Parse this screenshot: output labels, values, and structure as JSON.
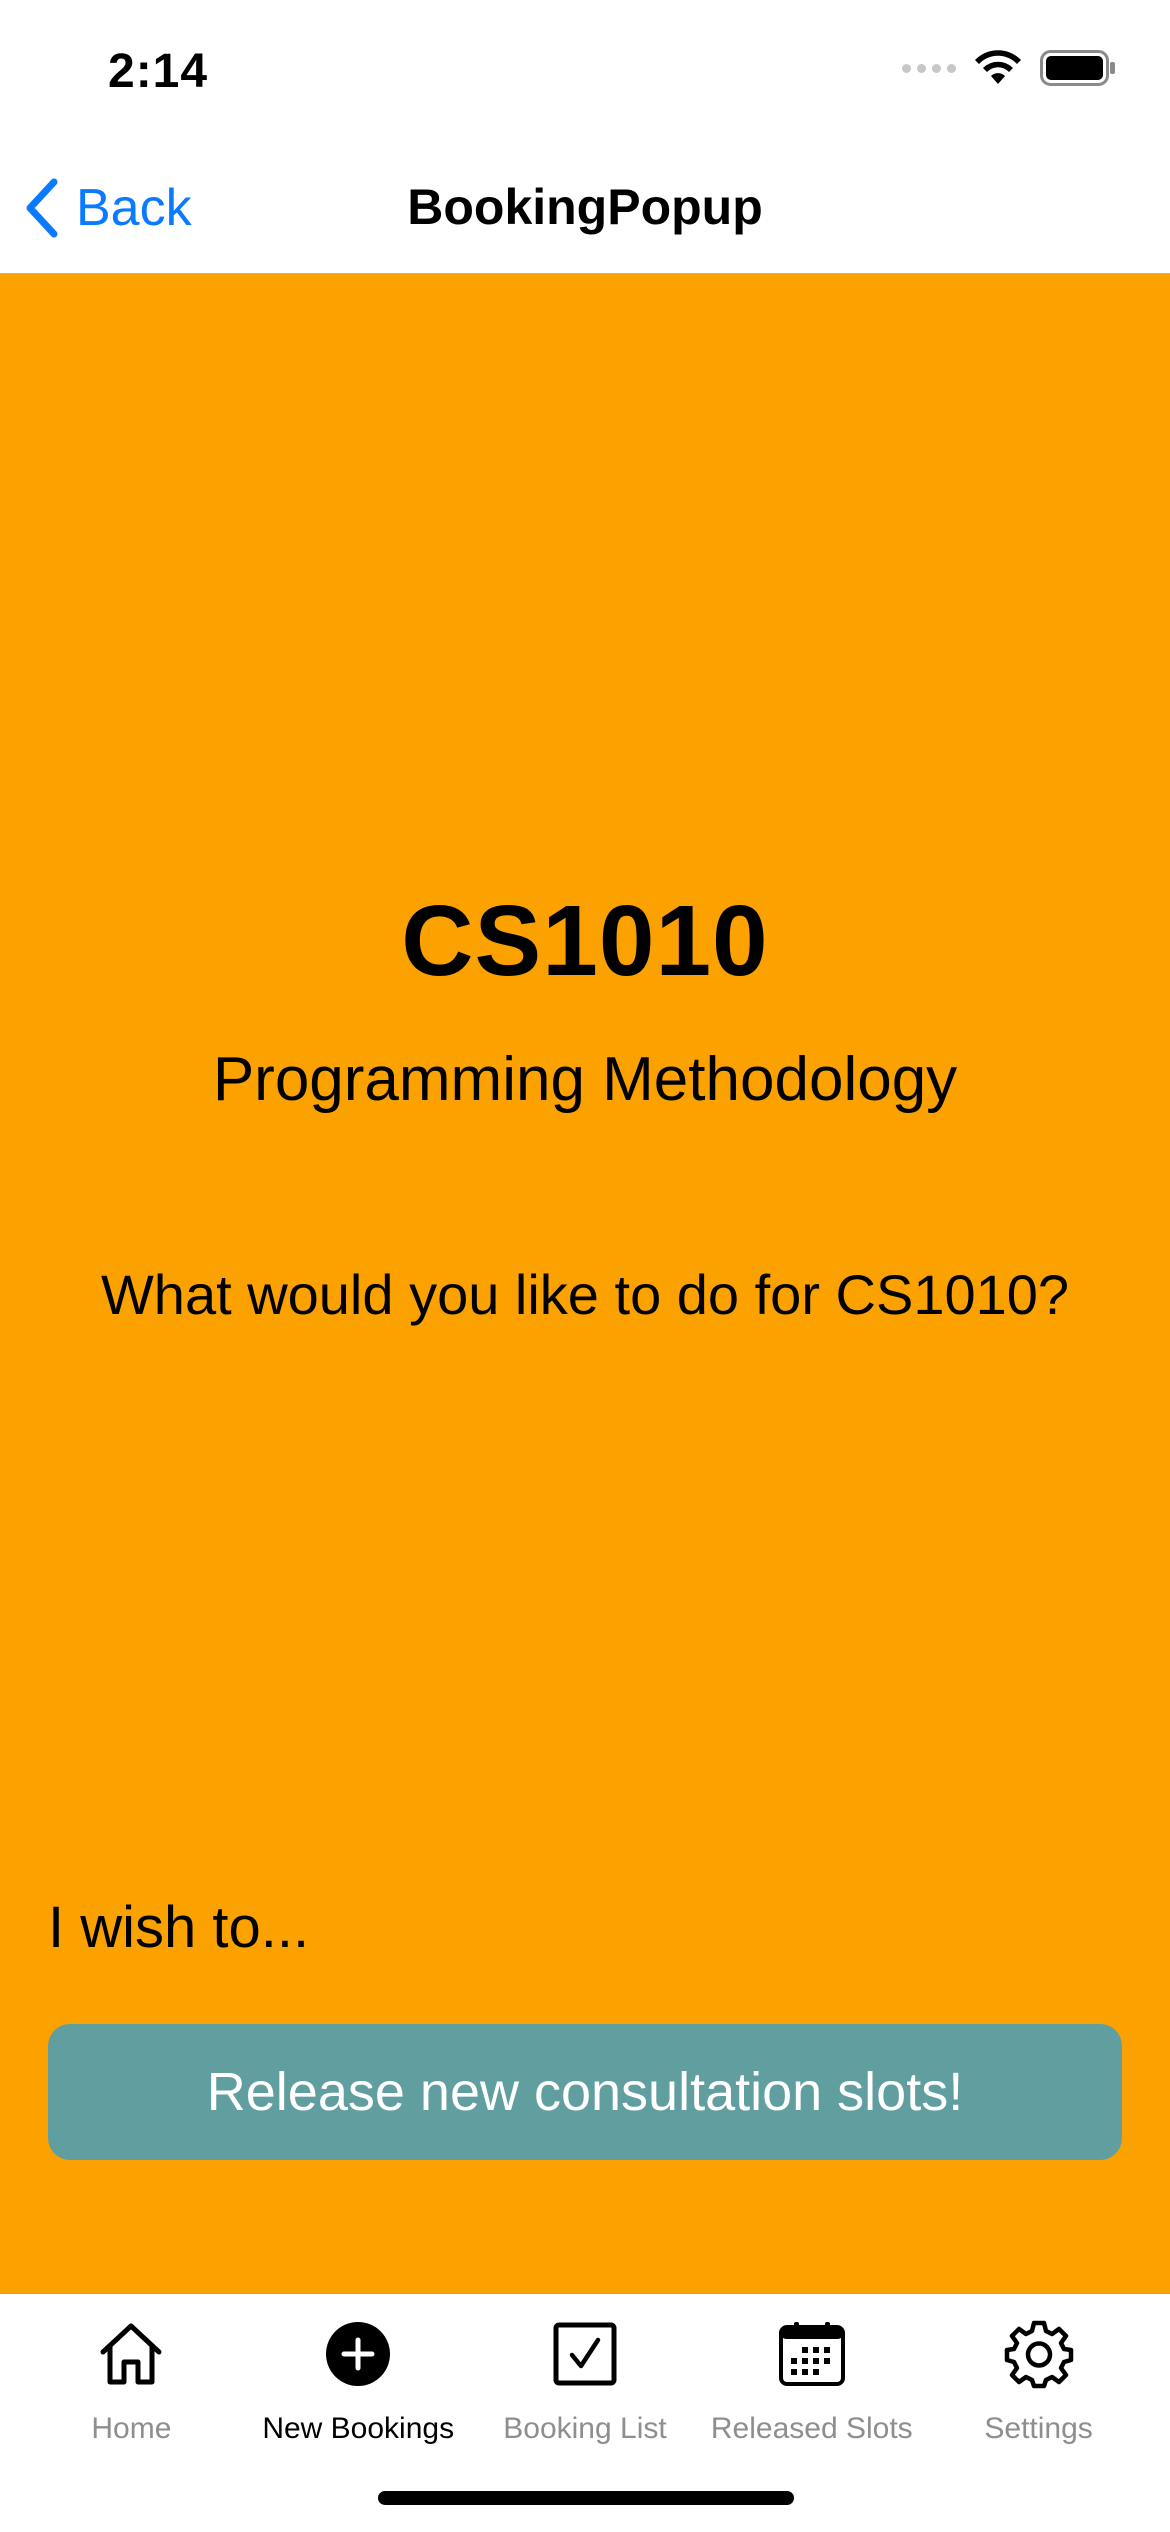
{
  "status_bar": {
    "time": "2:14"
  },
  "nav": {
    "back_label": "Back",
    "title": "BookingPopup"
  },
  "content": {
    "course_code": "CS1010",
    "course_name": "Programming Methodology",
    "question": "What would you like to do for CS1010?",
    "wish_label": "I wish to...",
    "release_button_label": "Release new consultation slots!"
  },
  "tabs": [
    {
      "label": "Home",
      "icon": "house-icon",
      "active": false
    },
    {
      "label": "New Bookings",
      "icon": "plus-circle-icon",
      "active": true
    },
    {
      "label": "Booking List",
      "icon": "checkbox-icon",
      "active": false
    },
    {
      "label": "Released Slots",
      "icon": "calendar-icon",
      "active": false
    },
    {
      "label": "Settings",
      "icon": "gear-icon",
      "active": false
    }
  ],
  "colors": {
    "accent": "#0a7aff",
    "background": "#fba200",
    "button": "#609ea0"
  }
}
